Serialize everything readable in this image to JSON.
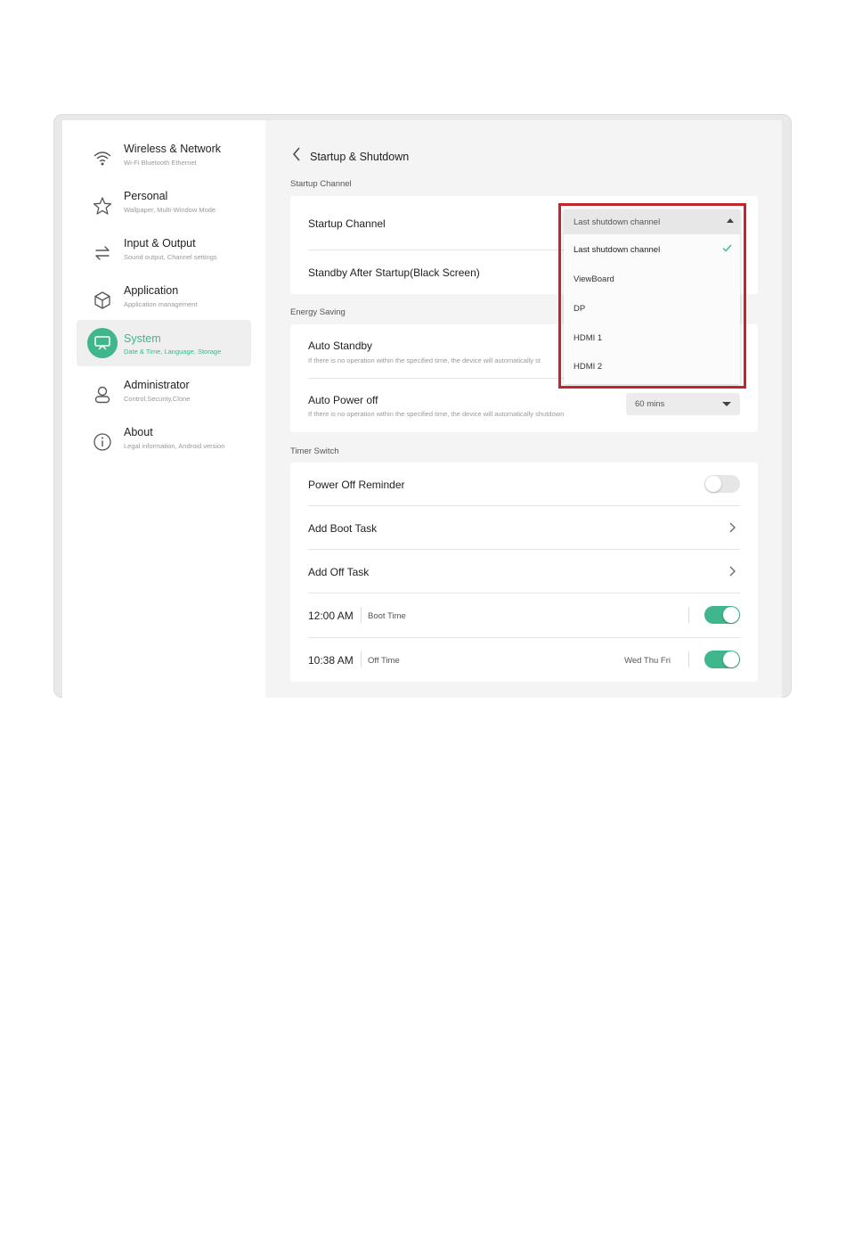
{
  "sidebar": {
    "items": [
      {
        "title": "Wireless & Network",
        "sub": "Wi-Fi Bluetooth Ethernet",
        "icon": "wifi-icon"
      },
      {
        "title": "Personal",
        "sub": "Wallpaper, Multi-Window Mode",
        "icon": "star-icon"
      },
      {
        "title": "Input & Output",
        "sub": "Sound output, Channel settings",
        "icon": "swap-arrows-icon"
      },
      {
        "title": "Application",
        "sub": "Application management",
        "icon": "cube-icon"
      },
      {
        "title": "System",
        "sub": "Date & Time, Language, Storage",
        "icon": "display-icon",
        "active": true
      },
      {
        "title": "Administrator",
        "sub": "Control,Security,Clone",
        "icon": "person-icon"
      },
      {
        "title": "About",
        "sub": "Legal information, Android version",
        "icon": "info-icon"
      }
    ]
  },
  "header": {
    "title": "Startup & Shutdown"
  },
  "startup": {
    "section_label": "Startup Channel",
    "channel_label": "Startup Channel",
    "standby_label": "Standby After Startup(Black Screen)"
  },
  "energy": {
    "section_label": "Energy Saving",
    "auto_standby": {
      "title": "Auto Standby",
      "desc": "If there is no operation within the specified time, the device will automatically st"
    },
    "auto_power_off": {
      "title": "Auto Power off",
      "desc": "If there is no operation within the specified time, the device will automatically shutdown",
      "value": "60 mins"
    }
  },
  "timer": {
    "section_label": "Timer Switch",
    "power_off_reminder": {
      "label": "Power Off Reminder",
      "on": false
    },
    "add_boot_task": "Add Boot Task",
    "add_off_task": "Add Off Task",
    "tasks": [
      {
        "time": "12:00 AM",
        "type": "Boot Time",
        "days": "",
        "on": true
      },
      {
        "time": "10:38 AM",
        "type": "Off Time",
        "days": "Wed Thu Fri",
        "on": true
      }
    ]
  },
  "dropdown": {
    "selected": "Last shutdown channel",
    "options": [
      "Last shutdown channel",
      "ViewBoard",
      "DP",
      "HDMI 1",
      "HDMI 2"
    ]
  },
  "colors": {
    "accent": "#3fb68b",
    "highlight": "#c4252c"
  }
}
